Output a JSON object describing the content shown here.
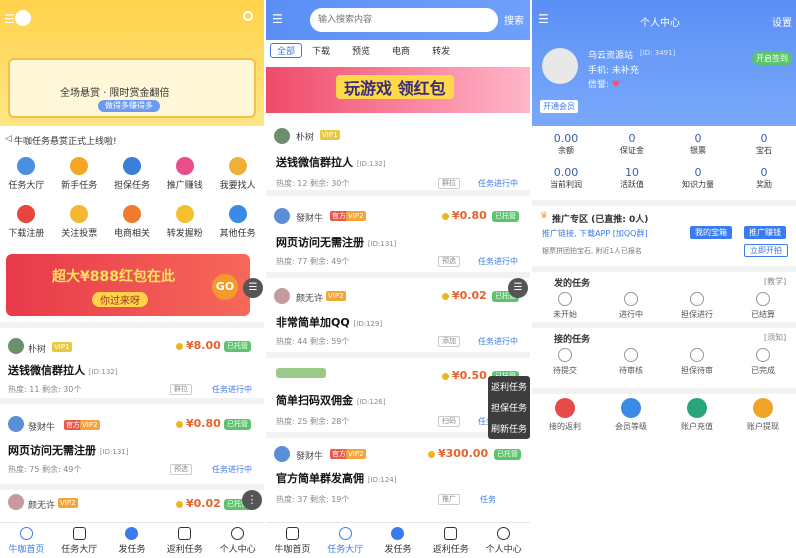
{
  "panel1": {
    "banner_line1": "全场悬赏 · 限时赏金翻倍",
    "banner_button": "做得多赚得多",
    "announcement": "牛咖任务悬赏正式上线啦!",
    "grid_row1": [
      "任务大厅",
      "新手任务",
      "担保任务",
      "推广赚钱",
      "我要找人"
    ],
    "grid_row2": [
      "下载注册",
      "关注投票",
      "电商相关",
      "转发握粉",
      "其他任务"
    ],
    "promo_text": "超大¥888红包在此",
    "promo_sub": "你过来呀",
    "promo_go": "GO",
    "tasks": [
      {
        "user": "朴树",
        "vip": "VIP1",
        "price": "¥8.00",
        "badge": "已托管",
        "title": "送钱微信群拉人",
        "id": "[ID:132]",
        "heat": "热度: 11",
        "remain": "剩余: 30个",
        "chip": "群拉",
        "status": "任务进行中"
      },
      {
        "user": "發财牛",
        "vip": "VIP2",
        "tag": "官方",
        "price": "¥0.80",
        "badge": "已托管",
        "title": "网页访问无需注册",
        "id": "[ID:131]",
        "heat": "热度: 75",
        "remain": "剩余: 49个",
        "chip": "预选",
        "status": "任务进行中"
      },
      {
        "user": "颜无许",
        "vip": "VIP2",
        "price": "¥0.02",
        "badge": "已托管"
      }
    ],
    "tabs": [
      "牛咖首页",
      "任务大厅",
      "发任务",
      "返利任务",
      "个人中心"
    ]
  },
  "panel2": {
    "search_placeholder": "输入搜索内容",
    "search_button": "搜索",
    "filters": [
      "全部",
      "下载",
      "预览",
      "电商",
      "转发"
    ],
    "banner_text": "玩游戏 领红包",
    "tasks": [
      {
        "user": "朴树",
        "vip": "VIP1",
        "title": "送钱微信群拉人",
        "id": "[ID:132]",
        "heat": "热度: 12",
        "remain": "剩余: 30个",
        "chip": "群拉",
        "status": "任务进行中"
      },
      {
        "user": "發财牛",
        "vip": "VIP2",
        "tag": "官方",
        "price": "¥0.80",
        "badge": "已托管",
        "title": "网页访问无需注册",
        "id": "[ID:131]",
        "heat": "热度: 77",
        "remain": "剩余: 49个",
        "chip": "预选",
        "status": "任务进行中"
      },
      {
        "user": "颜无许",
        "vip": "VIP2",
        "price": "¥0.02",
        "badge": "已托管",
        "title": "非常简单加QQ",
        "id": "[ID:129]",
        "heat": "热度: 44",
        "remain": "剩余: 59个",
        "chip": "添加",
        "status": "任务进行中"
      },
      {
        "price": "¥0.50",
        "badge": "已托管",
        "title": "简单扫码双佣金",
        "id": "[ID:126]",
        "heat": "热度: 25",
        "remain": "剩余: 28个",
        "chip": "扫码",
        "status": "任务进行中"
      },
      {
        "user": "發财牛",
        "vip": "VIP2",
        "tag": "官方",
        "price": "¥300.00",
        "badge": "已托管",
        "title": "官方简单群发高佣",
        "id": "[ID:124]",
        "heat": "热度: 37",
        "remain": "剩余: 19个",
        "chip": "推广",
        "status": "任务"
      }
    ],
    "float_menu": [
      "返利任务",
      "担保任务",
      "刷新任务"
    ],
    "tabs": [
      "牛咖首页",
      "任务大厅",
      "发任务",
      "返利任务",
      "个人中心"
    ]
  },
  "panel3": {
    "title": "个人中心",
    "settings": "设置",
    "site": "乌云资源站",
    "uid": "[ID: 3491]",
    "phone": "手机: 未补充",
    "credit": "信誉: ",
    "signin": "开启签到",
    "vip_btn": "开通会员",
    "stats1": [
      {
        "v": "0.00",
        "l": "余额"
      },
      {
        "v": "0",
        "l": "保证金"
      },
      {
        "v": "0",
        "l": "银票"
      },
      {
        "v": "0",
        "l": "宝石"
      }
    ],
    "stats2": [
      {
        "v": "0.00",
        "l": "当前利润"
      },
      {
        "v": "10",
        "l": "活跃值"
      },
      {
        "v": "0",
        "l": "知识力量"
      },
      {
        "v": "0",
        "l": "奖励"
      }
    ],
    "promo_title": "推广专区 (已直推: 0人)",
    "promo_line": "推广链接, 下载APP [加QQ群]",
    "promo_line2": "银票拼团拍宝石, 附近1人已报名",
    "btn_gems": "我的宝箱",
    "btn_promote": "推广赚钱",
    "btn_share": "立即开拍",
    "sec1": "发的任务",
    "sec1_more": "[教学]",
    "row1": [
      "未开始",
      "进行中",
      "担保进行",
      "已结算"
    ],
    "sec2": "接的任务",
    "sec2_more": "[须知]",
    "row2": [
      "待提交",
      "待审核",
      "担保待审",
      "已完成"
    ],
    "row3": [
      "接的返利",
      "会员等级",
      "账户充值",
      "账户提现"
    ]
  }
}
